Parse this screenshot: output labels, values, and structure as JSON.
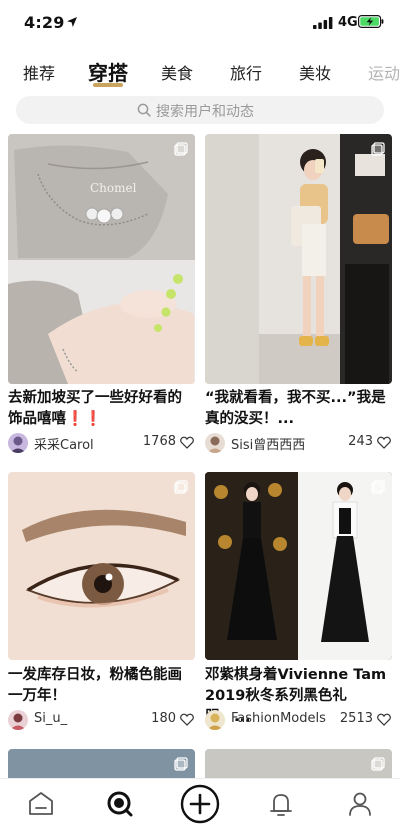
{
  "status_bar": {
    "time": "4:29",
    "network": "4G",
    "icons": [
      "location-arrow-icon",
      "signal-icon",
      "battery-charging-icon"
    ]
  },
  "tabs": [
    {
      "label": "推荐",
      "active": false
    },
    {
      "label": "穿搭",
      "active": true
    },
    {
      "label": "美食",
      "active": false
    },
    {
      "label": "旅行",
      "active": false
    },
    {
      "label": "美妆",
      "active": false
    },
    {
      "label": "运动",
      "active": false
    }
  ],
  "search": {
    "placeholder": "搜索用户和动态",
    "icon": "search-icon"
  },
  "cards": [
    {
      "title": "去新加坡买了一些好好看的饰品嘻嘻❗️❗️",
      "author": "采采Carol",
      "likes": "1768",
      "image_text": "Chomel"
    },
    {
      "title": "“我就看看，我不买...”我是真的没买！...",
      "author": "Sisi曾西西西",
      "likes": "243"
    },
    {
      "title": "一发库存日妆，粉橘色能画一万年！",
      "author": "Si_u_",
      "likes": "180"
    },
    {
      "title": "邓紫棋身着Vivienne Tam 2019秋冬系列黑色礼服，...",
      "author": "FashionModels",
      "likes": "2513"
    }
  ],
  "bottom_nav": [
    {
      "name": "home-icon"
    },
    {
      "name": "discover-icon"
    },
    {
      "name": "add-icon"
    },
    {
      "name": "notifications-icon"
    },
    {
      "name": "profile-icon"
    }
  ],
  "colors": {
    "accent": "#c9a45c",
    "heart_red": "#e0303a",
    "search_bg": "#f2f2f2"
  }
}
